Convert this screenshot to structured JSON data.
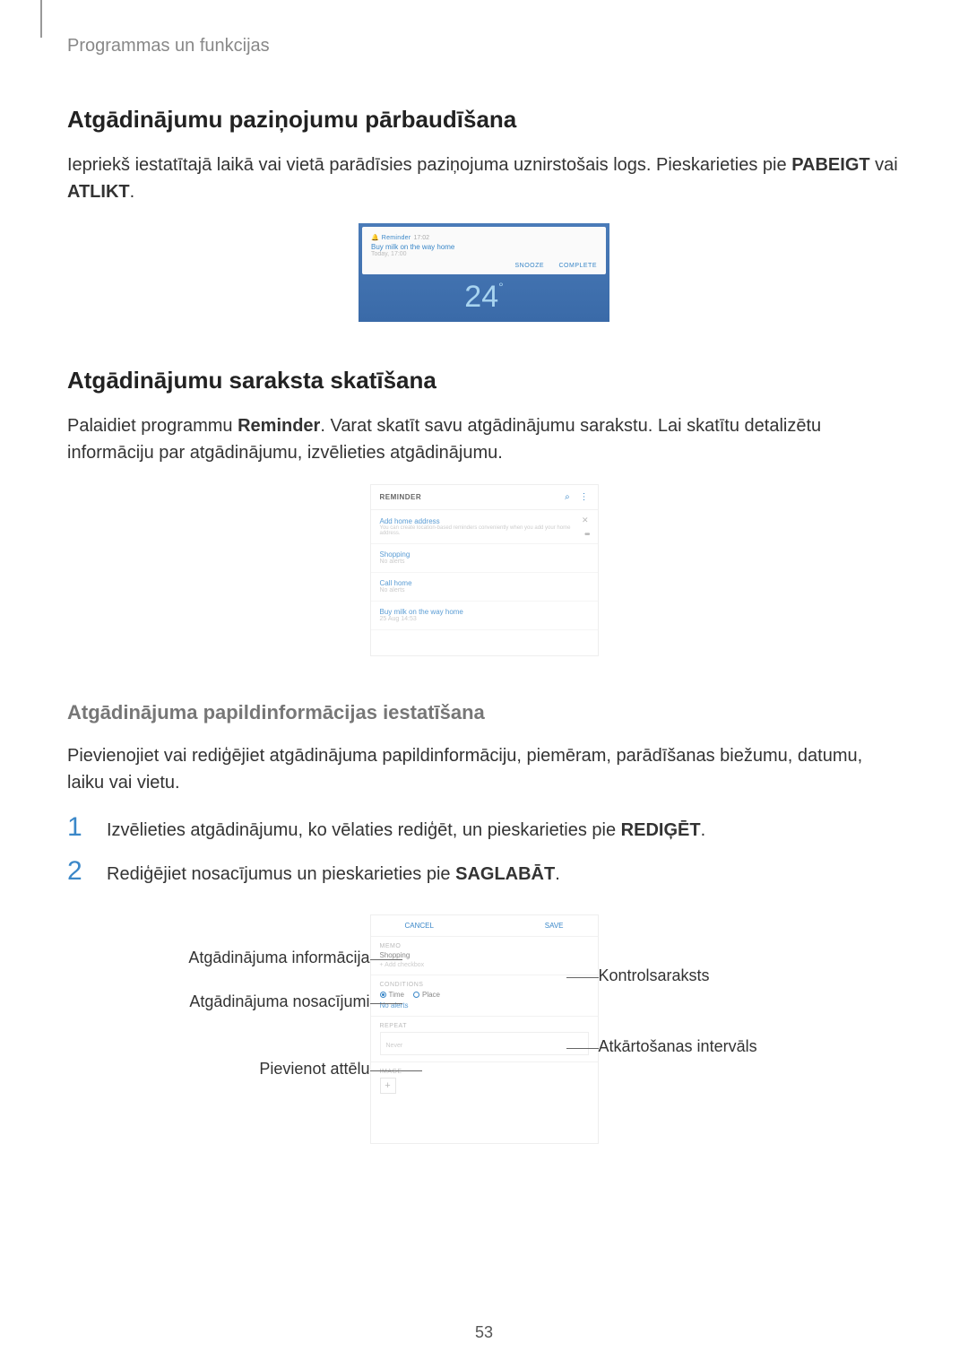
{
  "header": "Programmas un funkcijas",
  "section1": {
    "title": "Atgādinājumu paziņojumu pārbaudīšana",
    "p_before": "Iepriekš iestatītajā laikā vai vietā parādīsies paziņojuma uznirstošais logs. Pieskarieties pie ",
    "b1": "PABEIGT",
    "or": " vai ",
    "b2": "ATLIKT",
    "end": "."
  },
  "fig1": {
    "app": "Reminder",
    "time": "17:02",
    "title": "Buy milk on the way home",
    "sub": "Today, 17:00",
    "snooze": "SNOOZE",
    "complete": "COMPLETE",
    "clock": "24"
  },
  "section2": {
    "title": "Atgādinājumu saraksta skatīšana",
    "p_before": "Palaidiet programmu ",
    "b1": "Reminder",
    "p_after": ". Varat skatīt savu atgādinājumu sarakstu. Lai skatītu detalizētu informāciju par atgādinājumu, izvēlieties atgādinājumu."
  },
  "fig2": {
    "header": "REMINDER",
    "card_title": "Add home address",
    "card_sub": "You can create location-based reminders conveniently when you add your home address.",
    "items": [
      {
        "t": "Shopping",
        "s": "No alerts"
      },
      {
        "t": "Call home",
        "s": "No alerts"
      },
      {
        "t": "Buy milk on the way home",
        "s": "25 Aug 14:53"
      }
    ]
  },
  "sub1": {
    "title": "Atgādinājuma papildinformācijas iestatīšana",
    "p": "Pievienojiet vai rediģējiet atgādinājuma papildinformāciju, piemēram, parādīšanas biežumu, datumu, laiku vai vietu."
  },
  "steps": [
    {
      "n": "1",
      "before": "Izvēlieties atgādinājumu, ko vēlaties rediģēt, un pieskarieties pie ",
      "b": "REDIĢĒT",
      "after": "."
    },
    {
      "n": "2",
      "before": "Rediģējiet nosacījumus un pieskarieties pie ",
      "b": "SAGLABĀT",
      "after": "."
    }
  ],
  "fig3": {
    "cancel": "CANCEL",
    "save": "SAVE",
    "memo_lbl": "MEMO",
    "memo_val": "Shopping",
    "memo_add": "Add checkbox",
    "cond_lbl": "CONDITIONS",
    "radio_time": "Time",
    "radio_place": "Place",
    "noalert": "No alerts",
    "repeat_lbl": "REPEAT",
    "repeat_val": "Never",
    "image_lbl": "IMAGE"
  },
  "callouts": {
    "l1": "Atgādinājuma informācija",
    "l2": "Atgādinājuma nosacījumi",
    "l3": "Pievienot attēlu",
    "r1": "Kontrolsaraksts",
    "r2": "Atkārtošanas intervāls"
  },
  "page_num": "53"
}
